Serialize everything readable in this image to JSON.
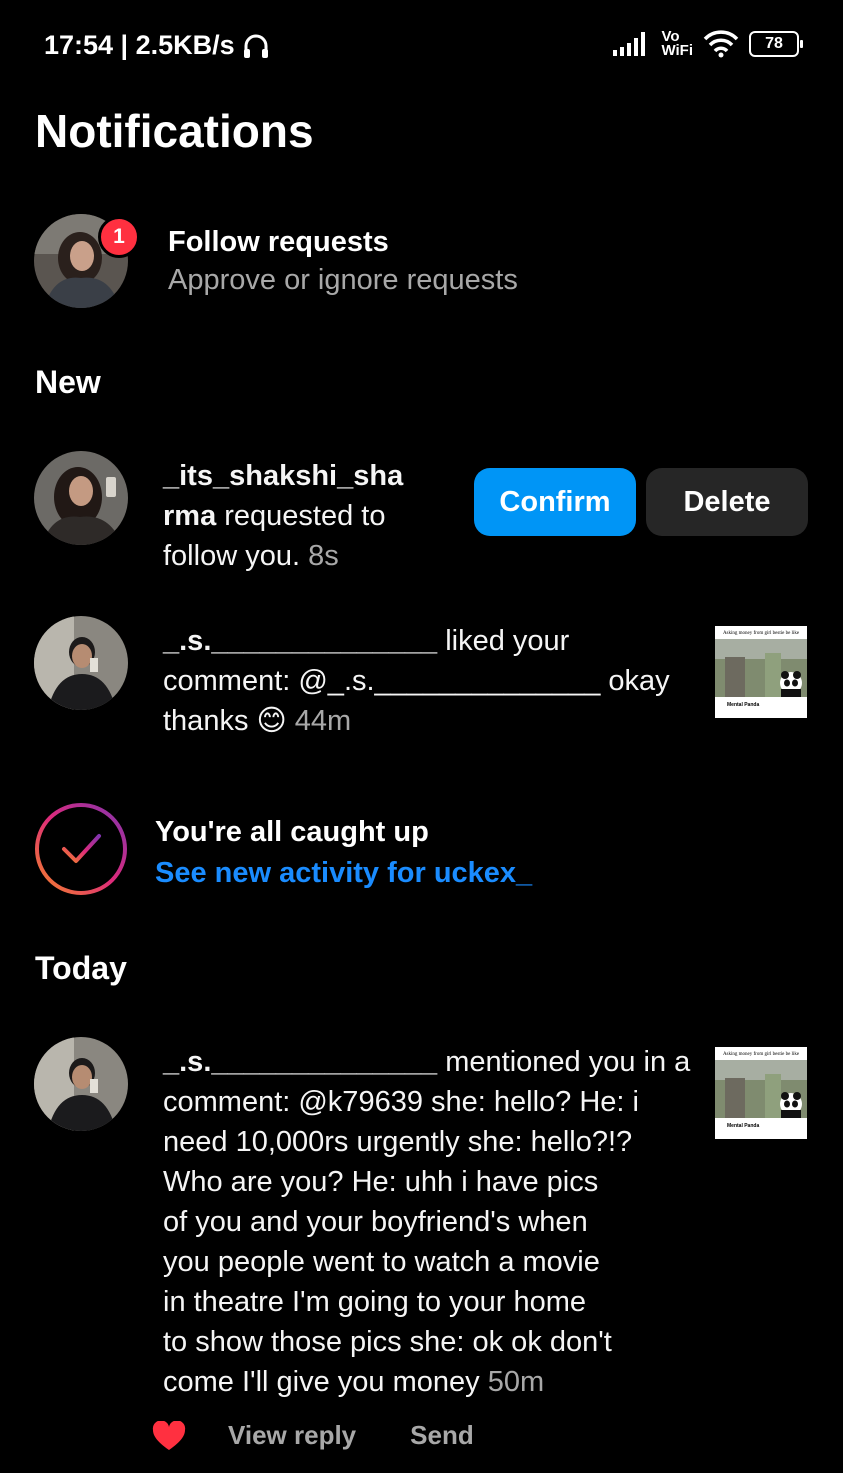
{
  "status_bar": {
    "time_speed": "17:54 | 2.5KB/s",
    "network_vo": "Vo",
    "network_wifi": "WiFi",
    "battery": "78"
  },
  "page": {
    "title": "Notifications"
  },
  "follow_requests": {
    "title": "Follow requests",
    "subtitle": "Approve or ignore requests",
    "badge": "1"
  },
  "sections": {
    "new": "New",
    "today": "Today"
  },
  "new_items": [
    {
      "username_part1": "_its_shakshi_sha",
      "username_part2": "rma",
      "text_part1": " requested to",
      "text_part2": "follow you.",
      "time": "8s",
      "confirm_label": "Confirm",
      "delete_label": "Delete"
    },
    {
      "username": "_.s.______________",
      "line1_rest": " liked your",
      "line2": "comment: @_.s.______________ okay",
      "line3": "thanks 😊",
      "time": "44m",
      "thumb_caption_top": "Asking money from girl bestie be like",
      "thumb_caption_bottom": "Mental Panda"
    }
  ],
  "caught_up": {
    "title": "You're all caught up",
    "link": "See new activity for uckex_"
  },
  "today_items": [
    {
      "username": "_.s.______________",
      "lines": [
        " mentioned you in a",
        "comment: @k79639 she: hello?  He: i",
        "need 10,000rs urgently  she: hello?!?",
        "Who are you?  He: uhh i have pics",
        "of you and your boyfriend's when",
        "you people went to watch a movie",
        "in theatre I'm going to your home",
        "to show those pics  she: ok ok don't",
        "come I'll give you money"
      ],
      "time": "50m",
      "thumb_caption_top": "Asking money from girl bestie be like",
      "thumb_caption_bottom": "Mental Panda",
      "view_reply": "View reply",
      "send": "Send"
    }
  ],
  "colors": {
    "background": "#000000",
    "accent_blue": "#0095f6",
    "link_blue": "#1a8cff",
    "badge_red": "#ff3040",
    "secondary_text": "#a8a8a8",
    "delete_button": "#262626"
  }
}
